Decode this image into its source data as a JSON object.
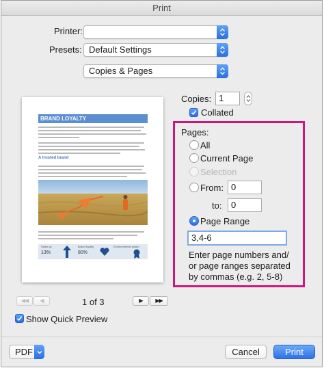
{
  "window": {
    "title": "Print"
  },
  "printer": {
    "label": "Printer:",
    "value": ""
  },
  "presets": {
    "label": "Presets:",
    "value": "Default Settings"
  },
  "section": {
    "value": "Copies & Pages"
  },
  "copies": {
    "label": "Copies:",
    "value": "1"
  },
  "collated": {
    "label": "Collated",
    "checked": true
  },
  "pages": {
    "title": "Pages:",
    "all_label": "All",
    "current_label": "Current Page",
    "selection_label": "Selection",
    "from_label": "From:",
    "from_value": "0",
    "to_label": "to:",
    "to_value": "0",
    "range_label": "Page Range",
    "range_value": "3,4-6",
    "selected": "Page Range",
    "hint": [
      "Enter page numbers and/",
      "or page ranges separated",
      "by commas (e.g. 2, 5-8)"
    ]
  },
  "preview": {
    "heading": "BRAND LOYALTY",
    "subheading": "A trusted brand",
    "stats": [
      "Sales up",
      "13%",
      "Brand loyalty",
      "80%",
      "Environmental award"
    ]
  },
  "navigation": {
    "page_indicator": "1 of 3",
    "first": "◀◀",
    "prev": "◀",
    "next": "▶",
    "last": "▶▶"
  },
  "show_preview": {
    "label": "Show Quick Preview",
    "checked": true
  },
  "footer": {
    "pdf_label": "PDF",
    "cancel_label": "Cancel",
    "print_label": "Print"
  },
  "colors": {
    "accent": "#2d72e6",
    "highlight": "#d0157d"
  }
}
